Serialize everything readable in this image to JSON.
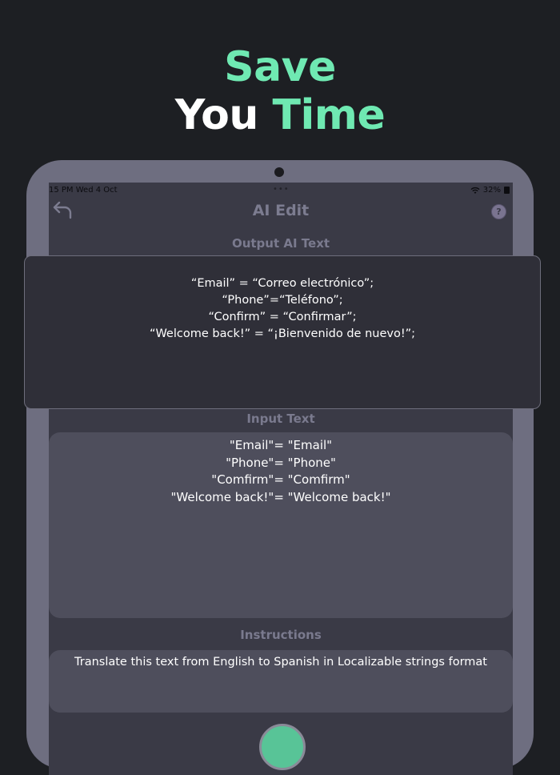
{
  "headline": {
    "line1": "Save",
    "line2_white": "You",
    "line2_green": "Time"
  },
  "status_bar": {
    "time_date": "15 PM  Wed 4 Oct",
    "dots": "•••",
    "battery": "32%"
  },
  "app": {
    "title": "AI Edit",
    "help": "?",
    "output_label": "Output AI Text",
    "input_label": "Input Text",
    "instructions_label": "Instructions"
  },
  "output_lines": [
    "“Email” = “Correo electrónico”;",
    "“Phone”=“Teléfono”;",
    "“Confirm” = “Confirmar”;",
    "“Welcome back!” = “¡Bienvenido de nuevo!”;"
  ],
  "input_lines": [
    "\"Email\"= \"Email\"",
    "\"Phone\"= \"Phone\"",
    "\"Comfirm\"= \"Comfirm\"",
    "\"Welcome back!\"= \"Welcome back!\""
  ],
  "instructions_text": "Translate this text from English to Spanish in Localizable strings format",
  "colors": {
    "background": "#1d1f23",
    "accent_green": "#6fe9b2",
    "device_frame": "#6e6e80",
    "text_box": "#4e4e5c",
    "overlay_card": "#2f2f38"
  },
  "icons": [
    "back-arrow-icon",
    "help-icon",
    "wifi-icon",
    "battery-icon",
    "brain-icon"
  ]
}
